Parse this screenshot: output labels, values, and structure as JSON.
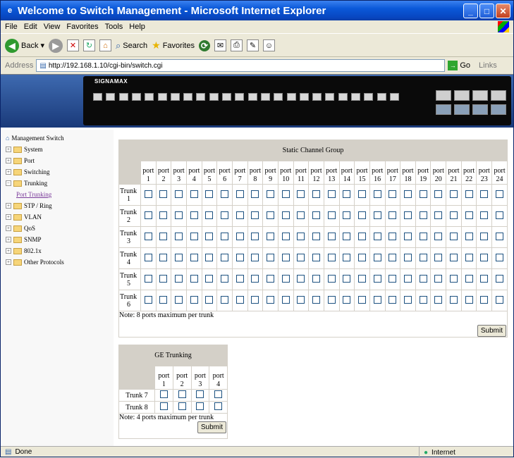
{
  "window": {
    "title": "Welcome to Switch Management - Microsoft Internet Explorer"
  },
  "menu": [
    "File",
    "Edit",
    "View",
    "Favorites",
    "Tools",
    "Help"
  ],
  "toolbar": {
    "back": "Back",
    "search": "Search",
    "favorites": "Favorites"
  },
  "address": {
    "label": "Address",
    "url": "http://192.168.1.10/cgi-bin/switch.cgi",
    "go": "Go",
    "links": "Links"
  },
  "banner": {
    "logo": "SIGNAMAX"
  },
  "sidebar": {
    "root": "Management Switch",
    "items": [
      "System",
      "Port",
      "Switching",
      "Trunking",
      "STP / Ring",
      "VLAN",
      "QoS",
      "SNMP",
      "802.1x",
      "Other Protocols"
    ],
    "sub": "Port Trunking"
  },
  "static_group": {
    "title": "Static Channel Group",
    "ports": [
      "1",
      "2",
      "3",
      "4",
      "5",
      "6",
      "7",
      "8",
      "9",
      "10",
      "11",
      "12",
      "13",
      "14",
      "15",
      "16",
      "17",
      "18",
      "19",
      "20",
      "21",
      "22",
      "23",
      "24"
    ],
    "port_word": "port",
    "trunks": [
      "1",
      "2",
      "3",
      "4",
      "5",
      "6"
    ],
    "trunk_word": "Trunk",
    "note": "Note: 8 ports maximum per trunk",
    "submit": "Submit"
  },
  "ge_group": {
    "title": "GE Trunking",
    "ports": [
      "1",
      "2",
      "3",
      "4"
    ],
    "port_word": "port",
    "trunks": [
      "Trunk 7",
      "Trunk 8"
    ],
    "note": "Note: 4 ports maximum per trunk",
    "submit": "Submit"
  },
  "status": {
    "left": "Done",
    "zone": "Internet"
  }
}
